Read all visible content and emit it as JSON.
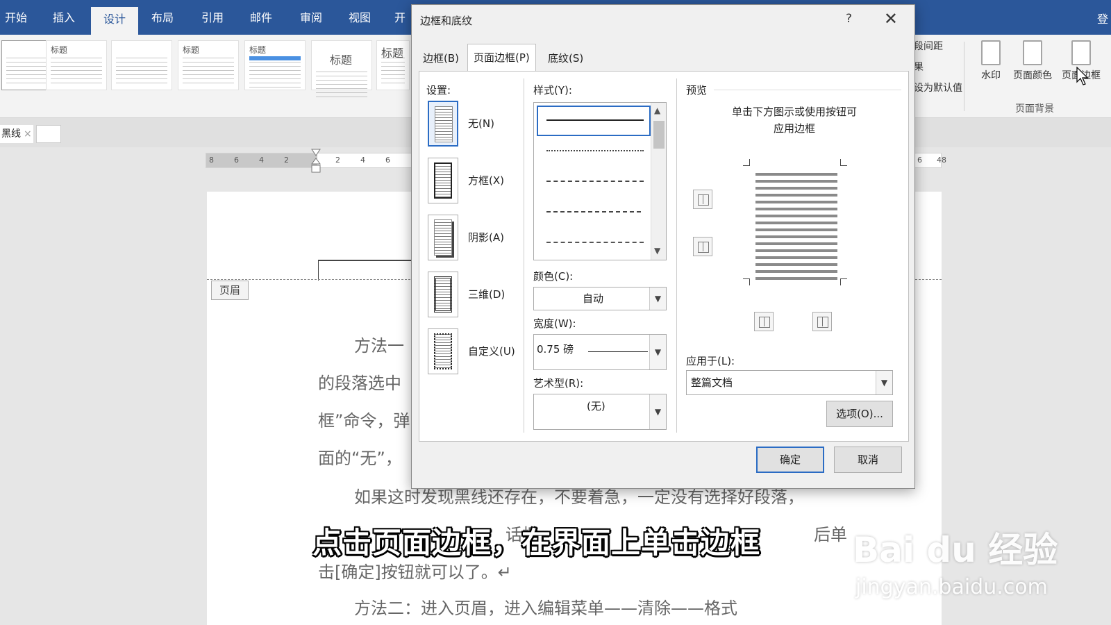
{
  "ribbon": {
    "tabs": [
      "开始",
      "插入",
      "设计",
      "布局",
      "引用",
      "邮件",
      "审阅",
      "视图",
      "开"
    ],
    "active_tab": "设计",
    "login_label": "登",
    "theme_titles": [
      "标题",
      "标题",
      "标题",
      "标题",
      "标题",
      "标题",
      "标题"
    ],
    "paragraph_spacing_label": "段间距",
    "effects_label": "果",
    "set_default_label": "设为默认值",
    "watermark_label": "水印",
    "page_color_label": "页面颜色",
    "page_borders_label": "页面边框",
    "page_background_group": "页面背景"
  },
  "doc_tab": {
    "label": "黑线",
    "close_glyph": "×"
  },
  "ruler": {
    "left_numbers": [
      "8",
      "6",
      "4",
      "2"
    ],
    "right_numbers": [
      "2",
      "4",
      "6"
    ],
    "far_right": [
      "6",
      "48"
    ]
  },
  "page": {
    "header_label": "页眉",
    "lines": [
      "方法一",
      "的段落选中",
      "框”命令，弹",
      "面的“无”，",
      "如果这时发现黑线还存在，不要着急，一定没有选择好段落，",
      "话框",
      "后单",
      "击[确定]按钮就可以了。↵",
      "方法二：进入页眉，进入编辑菜单——清除——格式"
    ]
  },
  "dialog": {
    "title": "边框和底纹",
    "help": "?",
    "close": "✕",
    "tabs": [
      "边框(B)",
      "页面边框(P)",
      "底纹(S)"
    ],
    "active_tab": "页面边框(P)",
    "settings_label": "设置:",
    "settings": [
      "无(N)",
      "方框(X)",
      "阴影(A)",
      "三维(D)",
      "自定义(U)"
    ],
    "selected_setting": "无(N)",
    "style_label": "样式(Y):",
    "color_label": "颜色(C):",
    "color_value": "自动",
    "width_label": "宽度(W):",
    "width_value": "0.75 磅",
    "art_label": "艺术型(R):",
    "art_value": "(无)",
    "preview_label": "预览",
    "preview_hint_1": "单击下方图示或使用按钮可",
    "preview_hint_2": "应用边框",
    "apply_label": "应用于(L):",
    "apply_value": "整篇文档",
    "options_button": "选项(O)...",
    "ok_button": "确定",
    "cancel_button": "取消"
  },
  "subtitle": "点击页面边框，在界面上单击边框",
  "watermark": {
    "brand": "Bai du 经验",
    "url": "jingyan.baidu.com"
  },
  "colors": {
    "ribbon_blue": "#2b579a",
    "focus_blue": "#2b6cc4"
  }
}
